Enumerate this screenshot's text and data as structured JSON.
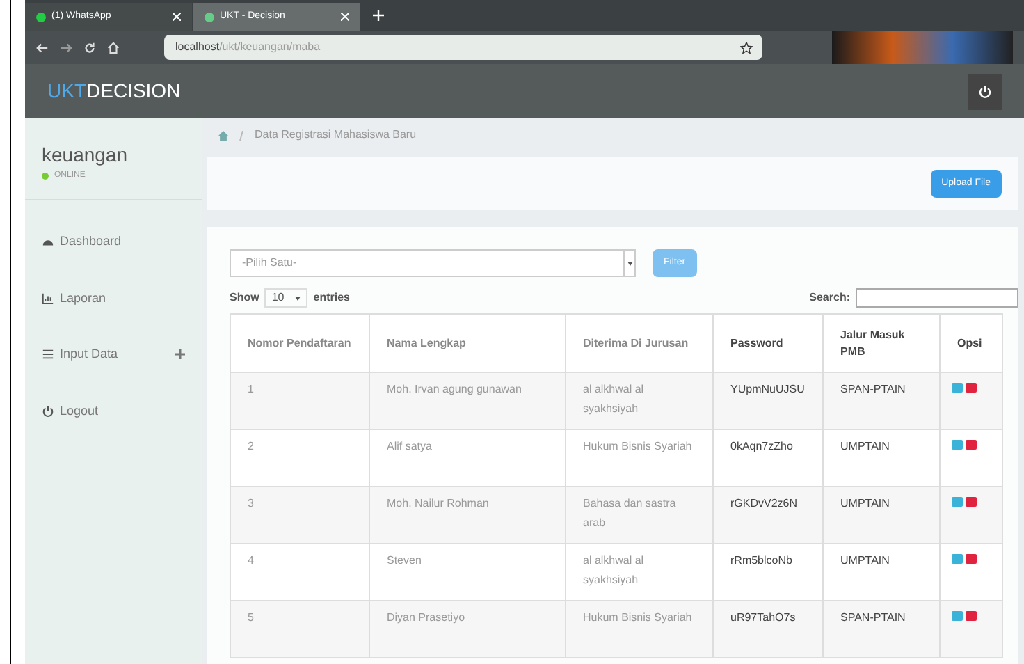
{
  "browser": {
    "tabs": [
      {
        "label": "(1) WhatsApp",
        "selected": false
      },
      {
        "label": "UKT - Decision",
        "selected": true
      }
    ],
    "url_host": "localhost",
    "url_path": "/ukt/keuangan/maba"
  },
  "navbar": {
    "brand_first": "UKT",
    "brand_rest": "DECISION"
  },
  "sidebar": {
    "user": "keuangan",
    "status": "ONLINE",
    "items": [
      {
        "label": "Dashboard",
        "expandable": false
      },
      {
        "label": "Laporan",
        "expandable": false
      },
      {
        "label": "Input Data",
        "expandable": true
      },
      {
        "label": "Logout",
        "expandable": false
      }
    ]
  },
  "breadcrumb": "Data Registrasi Mahasiswa Baru",
  "upload_button": "Upload File",
  "filter": {
    "placeholder": "-Pilih Satu-",
    "button": "Filter"
  },
  "length": {
    "show": "Show",
    "value": "10",
    "entries": "entries"
  },
  "search": {
    "label": "Search:"
  },
  "table": {
    "columns": [
      "Nomor Pendaftaran",
      "Nama Lengkap",
      "Diterima Di Jurusan",
      "Password",
      "Jalur Masuk PMB",
      "Opsi"
    ],
    "rows": [
      [
        "1",
        "Moh. Irvan agung gunawan",
        "al alkhwal al syakhsiyah",
        "YUpmNuUJSU",
        "SPAN-PTAIN"
      ],
      [
        "2",
        "Alif satya",
        "Hukum Bisnis Syariah",
        "0kAqn7zZho",
        "UMPTAIN"
      ],
      [
        "3",
        "Moh. Nailur Rohman",
        "Bahasa dan sastra arab",
        "rGKDvV2z6N",
        "UMPTAIN"
      ],
      [
        "4",
        "Steven",
        "al alkhwal al syakhsiyah",
        "rRm5blcoNb",
        "UMPTAIN"
      ],
      [
        "5",
        "Diyan Prasetiyo",
        "Hukum Bisnis Syariah",
        "uR97TahO7s",
        "SPAN-PTAIN"
      ]
    ]
  }
}
